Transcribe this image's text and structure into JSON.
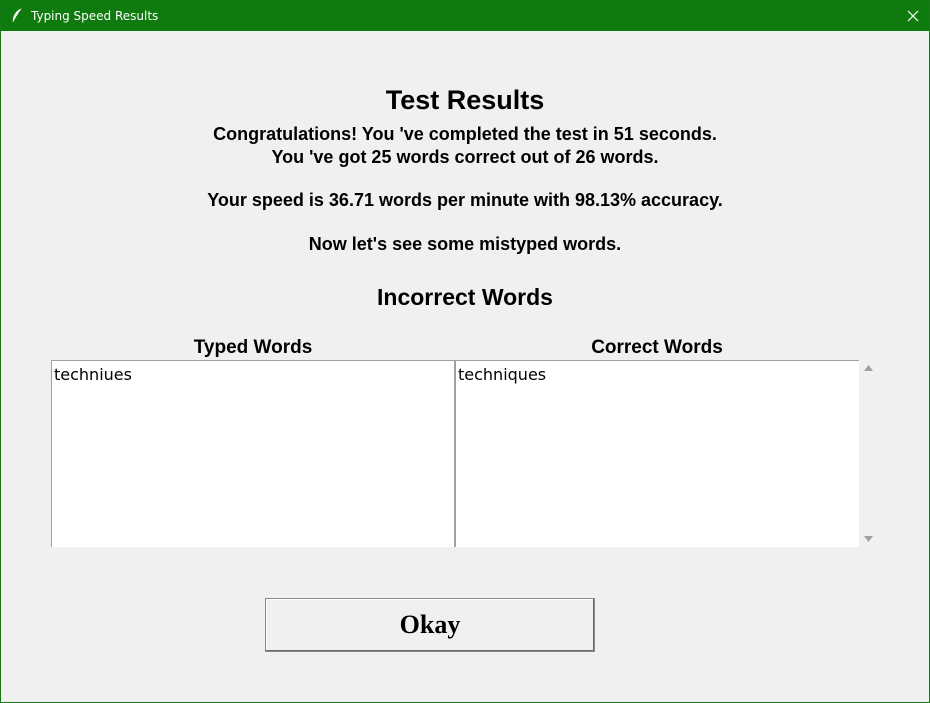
{
  "window": {
    "title": "Typing Speed Results",
    "icon": "feather-icon",
    "titlebar_color": "#0f7b0f"
  },
  "results": {
    "heading": "Test Results",
    "line1": "Congratulations! You 've completed the test in 51 seconds.",
    "line2": "You 've got 25 words correct out of 26 words.",
    "line3": "Your speed is 36.71 words per minute with 98.13% accuracy.",
    "line4": "Now let's see some mistyped words."
  },
  "incorrect": {
    "heading": "Incorrect Words",
    "typed_label": "Typed Words",
    "correct_label": "Correct Words",
    "typed_words": [
      "techniues"
    ],
    "correct_words": [
      "techniques"
    ]
  },
  "buttons": {
    "okay_label": "Okay"
  }
}
